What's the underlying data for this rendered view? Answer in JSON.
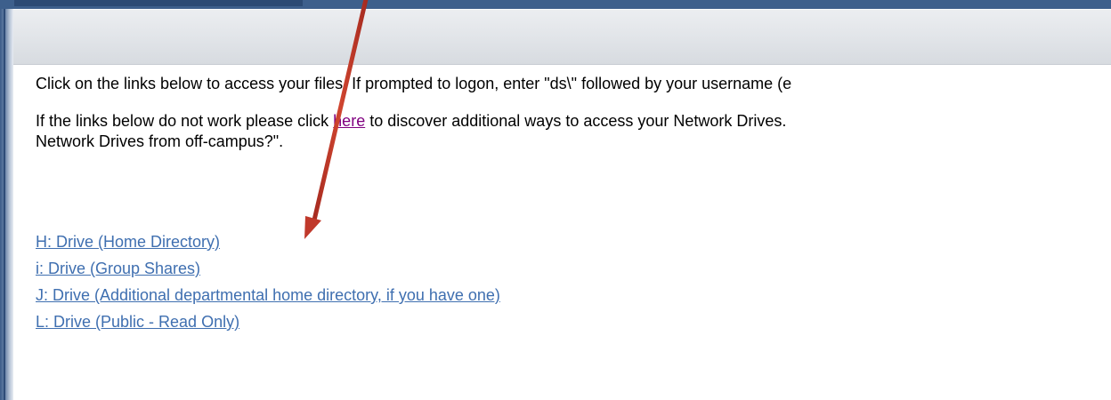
{
  "intro": {
    "line1": "Click on the links below to access your files. If prompted to logon, enter \"ds\\\" followed by your username (e",
    "line2_before": "If the links below do not work please click ",
    "line2_link": "here",
    "line2_after": " to discover additional ways to access your Network Drives. ",
    "line3": "Network Drives from off-campus?\"."
  },
  "drives": [
    {
      "label": "H: Drive (Home Directory)"
    },
    {
      "label": "i: Drive (Group Shares)"
    },
    {
      "label": "J: Drive (Additional departmental home directory, if you have one)"
    },
    {
      "label": "L: Drive (Public - Read Only)"
    }
  ],
  "colors": {
    "arrow": "#c0392b",
    "link": "#3f6fb0",
    "visited_link": "#800080",
    "frame": "#3d5f8c"
  }
}
